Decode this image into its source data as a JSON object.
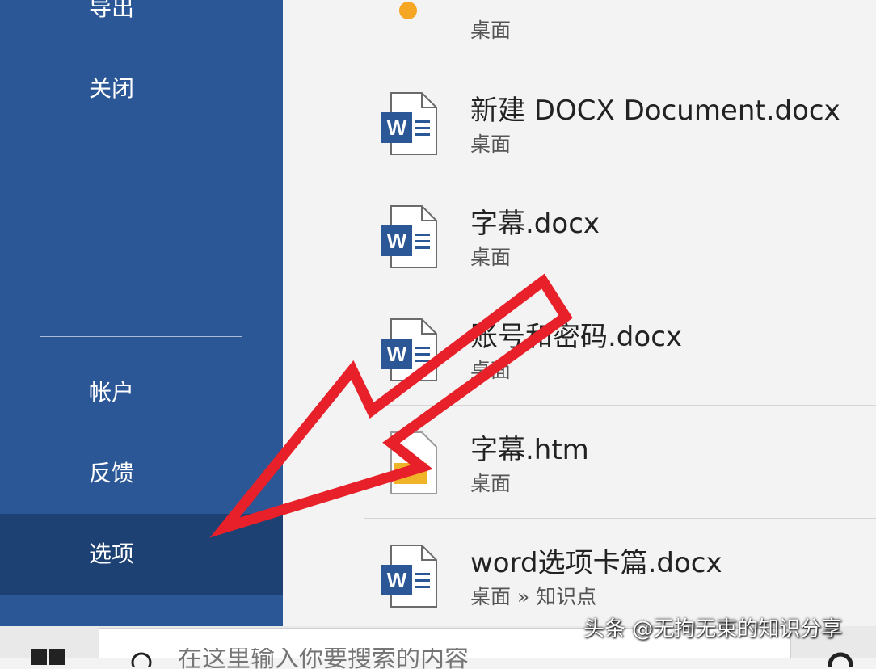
{
  "sidebar": {
    "items": [
      {
        "label": "导出"
      },
      {
        "label": "关闭"
      },
      {
        "label": "帐户"
      },
      {
        "label": "反馈"
      },
      {
        "label": "选项",
        "selected": true
      }
    ]
  },
  "recent_files": [
    {
      "name": "新建 DOCX Document.docx",
      "location": "桌面",
      "icon": "word-doc-icon"
    },
    {
      "name": "字幕.docx",
      "location": "桌面",
      "icon": "word-doc-icon"
    },
    {
      "name": "账号和密码.docx",
      "location": "桌面",
      "icon": "word-doc-icon"
    },
    {
      "name": "字幕.htm",
      "location": "桌面",
      "icon": "html-file-icon"
    },
    {
      "name": "word选项卡篇.docx",
      "location": "桌面 » 知识点",
      "icon": "word-doc-icon"
    }
  ],
  "taskbar": {
    "search_placeholder": "在这里输入你要搜索的内容"
  },
  "watermark": "头条 @无拘无束的知识分享",
  "colors": {
    "sidebar_bg": "#2b5797",
    "sidebar_selected": "#1e4173",
    "word_blue": "#2b5797",
    "annotation_red": "#e8202a"
  }
}
